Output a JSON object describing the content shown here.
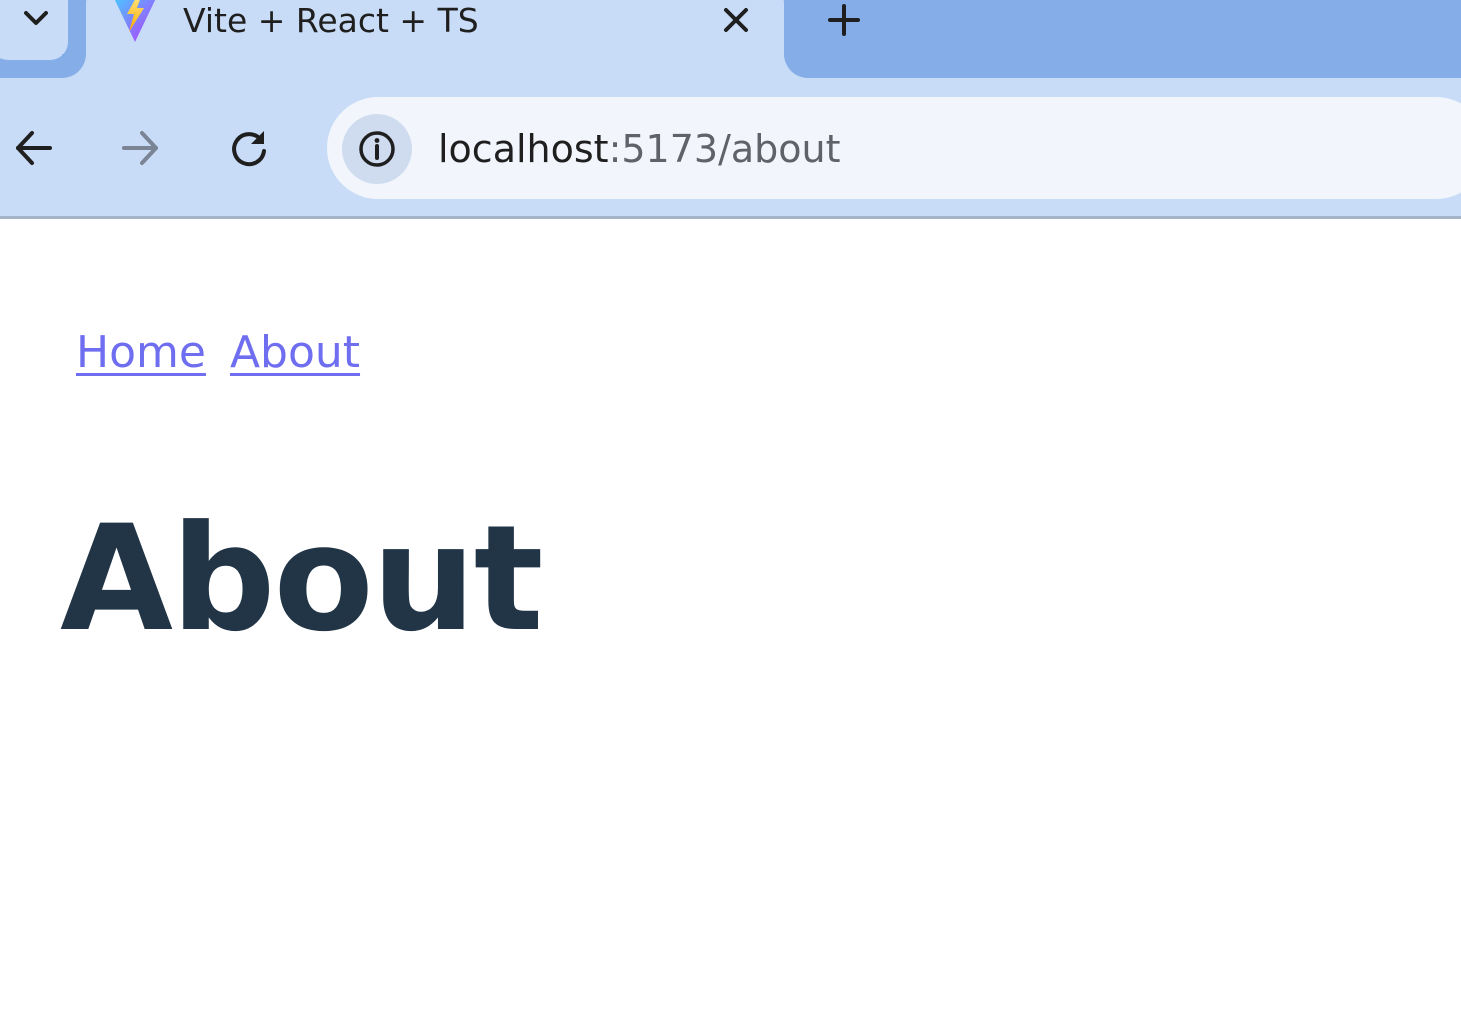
{
  "browser": {
    "tab": {
      "title": "Vite + React + TS",
      "favicon": "vite-logo-icon"
    },
    "icons": {
      "tab_search": "chevron-down-icon",
      "close_tab": "close-icon",
      "new_tab": "plus-icon",
      "back": "arrow-left-icon",
      "forward": "arrow-right-icon",
      "reload": "reload-icon",
      "site_info": "info-icon"
    },
    "address_bar": {
      "host": "localhost",
      "rest": ":5173/about"
    },
    "colors": {
      "tabstrip": "#85aee9",
      "toolbar": "#c9dcf7",
      "omnibox": "#f2f6fc"
    }
  },
  "page": {
    "nav": {
      "home_label": "Home",
      "about_label": "About"
    },
    "heading": "About",
    "colors": {
      "link": "#6f6ef0",
      "heading": "#213547"
    }
  }
}
